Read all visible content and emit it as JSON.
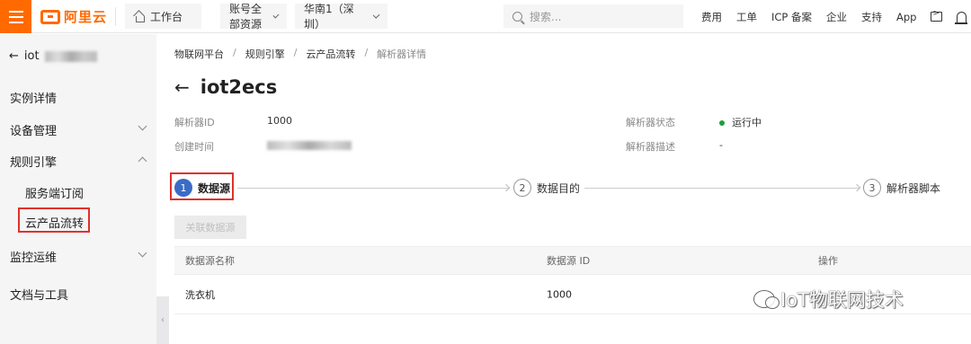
{
  "topbar": {
    "logo_text": "阿里云",
    "workbench": "工作台",
    "account": "账号全部资源",
    "region": "华南1（深圳）",
    "search_placeholder": "搜索...",
    "links": [
      "费用",
      "工单",
      "ICP 备案",
      "企业",
      "支持",
      "App"
    ]
  },
  "sidebar": {
    "back_label": "iot",
    "items": [
      {
        "label": "实例详情"
      },
      {
        "label": "设备管理"
      },
      {
        "label": "规则引擎"
      },
      {
        "label": "服务端订阅"
      },
      {
        "label": "云产品流转"
      },
      {
        "label": "监控运维"
      },
      {
        "label": "文档与工具"
      }
    ]
  },
  "breadcrumb": [
    "物联网平台",
    "规则引擎",
    "云产品流转",
    "解析器详情"
  ],
  "page_title": "iot2ecs",
  "info": {
    "id_label": "解析器ID",
    "id_value": "1000",
    "created_label": "创建时间",
    "status_label": "解析器状态",
    "status_value": "运行中",
    "desc_label": "解析器描述",
    "desc_value": "-"
  },
  "steps": [
    {
      "num": "1",
      "label": "数据源"
    },
    {
      "num": "2",
      "label": "数据目的"
    },
    {
      "num": "3",
      "label": "解析器脚本"
    }
  ],
  "link_button": "关联数据源",
  "table": {
    "headers": [
      "数据源名称",
      "数据源 ID",
      "操作"
    ],
    "rows": [
      [
        "洗衣机",
        "1000",
        ""
      ]
    ]
  },
  "watermark": "IoT物联网技术",
  "colors": {
    "brand": "#ff6a00",
    "step_active": "#3a6cc7",
    "status_ok": "#1e9e3e",
    "highlight": "#e0312b"
  }
}
